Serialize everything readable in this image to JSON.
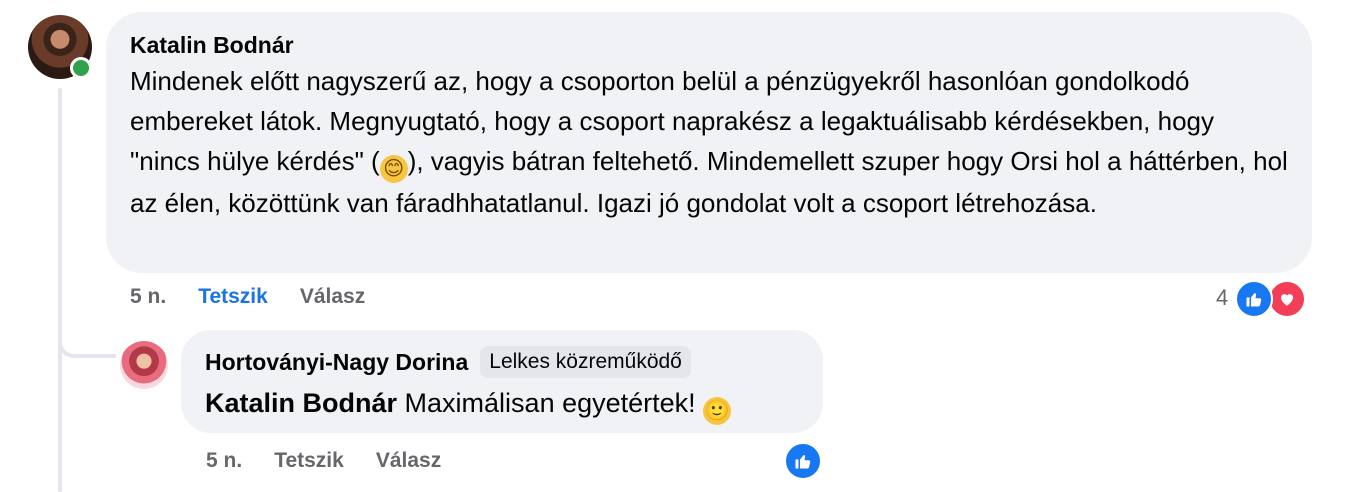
{
  "comment": {
    "author": "Katalin Bodnár",
    "text_part1": "Mindenek előtt nagyszerű az, hogy a csoporton belül a pénzügyekről hasonlóan gondolkodó embereket látok. Megnyugtató, hogy a csoport naprakész a legaktuálisabb kérdésekben, hogy \"nincs hülye kérdés\" (",
    "text_part2": "), vagyis bátran feltehető. Mindemellett szuper hogy Orsi hol a háttérben, hol az élen, közöttünk van fáradhhatatlanul. Igazi jó gondolat volt a csoport létrehozása.",
    "time": "5 n.",
    "like_label": "Tetszik",
    "reply_label": "Válasz",
    "reaction_count": "4",
    "emoji": "😊"
  },
  "reply": {
    "author": "Hortoványi-Nagy Dorina",
    "badge": "Lelkes közreműködő",
    "mention": "Katalin Bodnár",
    "text": "Maximálisan egyetértek!",
    "emoji": "🙂",
    "time": "5 n.",
    "like_label": "Tetszik",
    "reply_label": "Válasz"
  },
  "colors": {
    "bubble": "#f0f2f5",
    "accent_blue": "#1b74e4",
    "muted": "#65676b",
    "online": "#31a24c",
    "love": "#f33e58"
  },
  "icons": [
    "like-reaction-icon",
    "love-reaction-icon",
    "online-status-icon"
  ]
}
